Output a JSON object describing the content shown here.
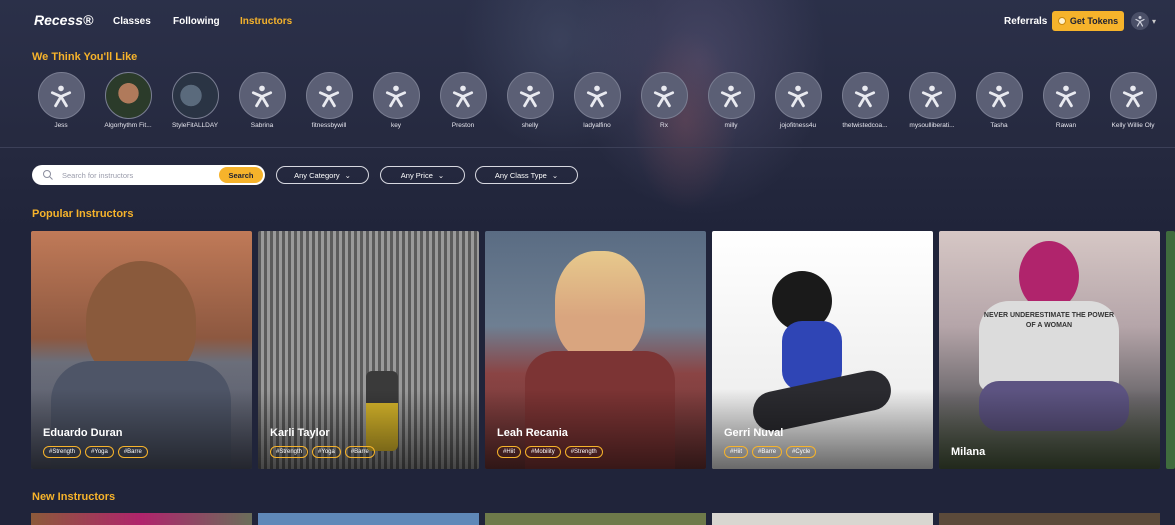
{
  "nav": {
    "logo": "Recess®",
    "links": [
      {
        "label": "Classes",
        "active": false
      },
      {
        "label": "Following",
        "active": false
      },
      {
        "label": "Instructors",
        "active": true
      }
    ],
    "referrals": "Referrals",
    "get_tokens": "Get Tokens",
    "user_icon": "user-icon",
    "caret": "▾"
  },
  "recommended": {
    "title": "We Think You'll Like",
    "items": [
      {
        "name": "Jess"
      },
      {
        "name": "Algorhythm Fit..."
      },
      {
        "name": "StyleFitALLDAY"
      },
      {
        "name": "Sabrina"
      },
      {
        "name": "fitnessbywill"
      },
      {
        "name": "key"
      },
      {
        "name": "Preston"
      },
      {
        "name": "shelly"
      },
      {
        "name": "ladyalfino"
      },
      {
        "name": "Rx"
      },
      {
        "name": "milly"
      },
      {
        "name": "jojofitness4u"
      },
      {
        "name": "thetwistedcoa..."
      },
      {
        "name": "mysoulliberati..."
      },
      {
        "name": "Tasha"
      },
      {
        "name": "Rawan"
      },
      {
        "name": "Kelly Willie Oly"
      }
    ]
  },
  "search": {
    "placeholder": "Search for instructors",
    "button": "Search"
  },
  "filters": [
    {
      "label": "Any Category"
    },
    {
      "label": "Any Price"
    },
    {
      "label": "Any Class Type"
    }
  ],
  "popular": {
    "title": "Popular Instructors",
    "cards": [
      {
        "name": "Eduardo Duran",
        "tags": [
          "#Strength",
          "#Yoga",
          "#Barre"
        ]
      },
      {
        "name": "Karli Taylor",
        "tags": [
          "#Strength",
          "#Yoga",
          "#Barre"
        ]
      },
      {
        "name": "Leah Recania",
        "tags": [
          "#Hiit",
          "#Mobility",
          "#Strength"
        ]
      },
      {
        "name": "Gerri Nuval",
        "tags": [
          "#Hiit",
          "#Barre",
          "#Cycle"
        ]
      },
      {
        "name": "Milana",
        "tags": []
      }
    ],
    "shirt_text": "NEVER UNDERESTIMATE THE POWER OF A WOMAN"
  },
  "new_instructors": {
    "title": "New Instructors"
  },
  "colors": {
    "accent": "#f6b32b",
    "background": "#20243a"
  }
}
